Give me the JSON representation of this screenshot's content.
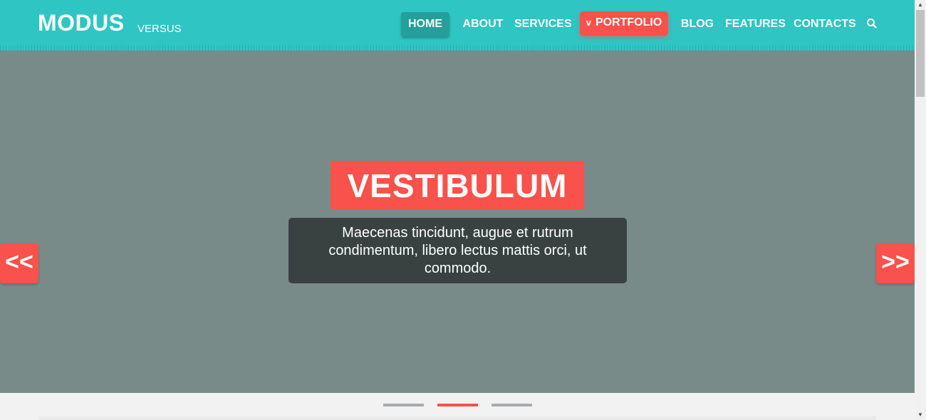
{
  "header": {
    "logo": "MODUS",
    "logo_sub": "VERSUS",
    "nav": {
      "home": "HOME",
      "about": "ABOUT",
      "services": "SERVICES",
      "portfolio": "PORTFOLIO",
      "portfolio_chevron": "v",
      "blog": "BLOG",
      "features": "FEATURES",
      "contacts": "CONTACTS"
    },
    "search_icon": "search-icon"
  },
  "hero": {
    "title": "VESTIBULUM",
    "caption": "Maecenas tincidunt, augue et rutrum condimentum, libero lectus mattis orci, ut commodo.",
    "prev_label": "<<",
    "next_label": ">>"
  },
  "slider": {
    "active_slide": 2,
    "slide_count": 3
  },
  "colors": {
    "header": "#2ec5c3",
    "accent": "#f9514b",
    "hero_bg": "#798b89",
    "caption_bg": "#394141"
  }
}
